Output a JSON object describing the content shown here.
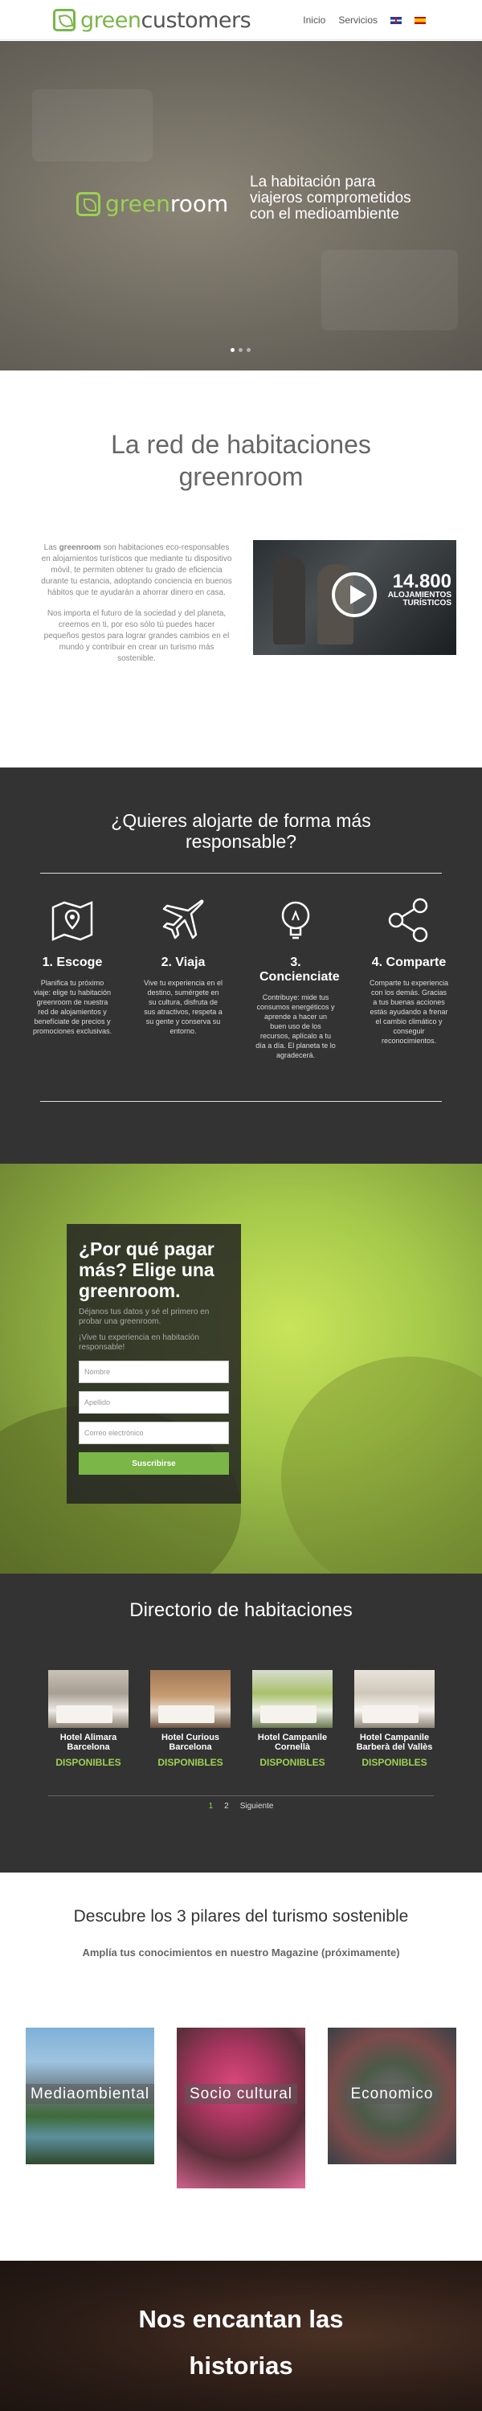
{
  "header": {
    "logo_green": "green",
    "logo_dark": "customers",
    "nav": [
      {
        "label": "Inicio"
      },
      {
        "label": "Servicios"
      }
    ],
    "flags": [
      "uk-flag",
      "es-flag"
    ]
  },
  "hero": {
    "logo_green": "green",
    "logo_white": "room",
    "tagline": "La habitación para viajeros comprometidos con el medioambiente",
    "slides": 3,
    "active_slide": 1
  },
  "intro": {
    "title": "La red de habitaciones greenroom",
    "p1_before": "Las ",
    "p1_bold": "greenroom",
    "p1_after": " son habitaciones eco-responsables en alojamientos turísticos que mediante tu dispositivo móvil, te permiten obtener tu grado de eficiencia durante tu estancia, adoptando conciencia en buenos hábitos que te ayudarán a ahorrar dinero en casa.",
    "p2": "Nos importa el futuro de la sociedad y del planeta, creemos en ti, por eso sólo tú puedes hacer pequeños gestos para lograr grandes cambios en el mundo y contribuir en crear un turismo más sostenible.",
    "video_stat_number": "14.800",
    "video_stat_label1": "ALOJAMIENTOS",
    "video_stat_label2": "TURÍSTICOS"
  },
  "steps": {
    "title": "¿Quieres alojarte de forma más responsable?",
    "items": [
      {
        "icon": "map-icon",
        "title": "1. Escoge",
        "desc": "Planifica tu próximo viaje: elige tu habitación greenroom de nuestra red de alojamientos y benefíciate de precios y promociones exclusivas."
      },
      {
        "icon": "plane-icon",
        "title": "2. Viaja",
        "desc": "Vive tu experiencia en el destino, sumérgete en su cultura, disfruta de sus atractivos, respeta a su gente y conserva su entorno."
      },
      {
        "icon": "lightbulb-icon",
        "title": "3. Concienciate",
        "desc": "Contribuye: mide tus consumos energéticos y aprende a hacer un buen uso de los recursos, aplícalo a tu día a día. El planeta te lo agradecerá."
      },
      {
        "icon": "share-icon",
        "title": "4. Comparte",
        "desc": "Comparte tu experiencia con los demás. Gracias a tus buenas acciones estás ayudando a frenar el cambio climático y conseguir reconocimientos."
      }
    ]
  },
  "cta": {
    "title": "¿Por qué pagar más? Elige una greenroom.",
    "sub1": "Déjanos tus datos y sé el primero en probar una greenroom.",
    "sub2": "¡Vive tu experiencia en habitación responsable!",
    "fields": [
      {
        "placeholder": "Nombre"
      },
      {
        "placeholder": "Apellido"
      },
      {
        "placeholder": "Correo electrónico"
      }
    ],
    "submit_label": "Suscribirse"
  },
  "directory": {
    "title": "Directorio de habitaciones",
    "hotels": [
      {
        "name": "Hotel Alimara Barcelona",
        "status": "DISPONIBLES"
      },
      {
        "name": "Hotel Curious Barcelona",
        "status": "DISPONIBLES"
      },
      {
        "name": "Hotel Campanile Cornellà",
        "status": "DISPONIBLES"
      },
      {
        "name": "Hotel Campanile Barberà del Vallès",
        "status": "DISPONIBLES"
      }
    ],
    "pagination": {
      "page1": "1",
      "page2": "2",
      "next": "Siguiente"
    }
  },
  "pillars": {
    "title": "Descubre los 3 pilares del turismo sostenible",
    "subtitle": "Amplía tus conocimientos en nuestro Magazine (próximamente)",
    "items": [
      {
        "label": "Mediaombiental"
      },
      {
        "label": "Socio cultural"
      },
      {
        "label": "Economico"
      }
    ]
  },
  "stories": {
    "title": "Nos encantan las historias"
  },
  "colors": {
    "brand_green": "#7ab648",
    "accent_green": "#9bd151",
    "dark_section": "#333333"
  }
}
